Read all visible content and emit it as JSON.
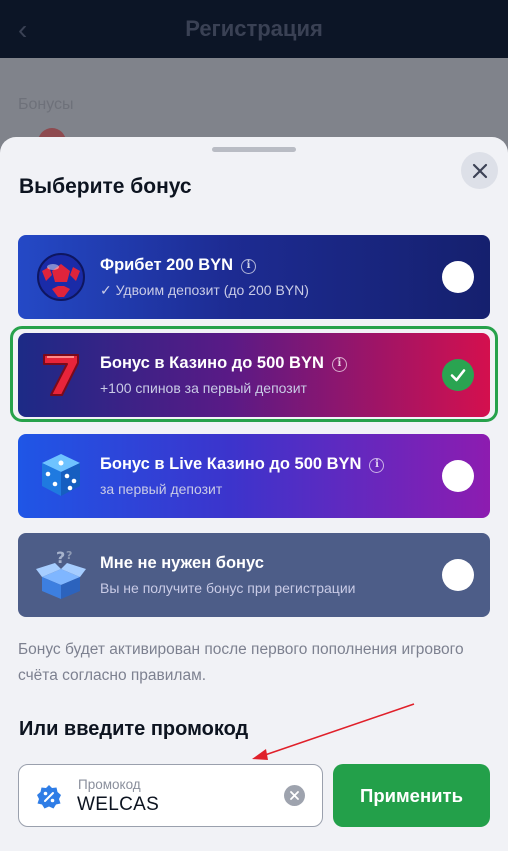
{
  "background": {
    "header_title": "Регистрация",
    "faint_text": "Бонусы"
  },
  "sheet": {
    "title": "Выберите бонус",
    "options": [
      {
        "title": "Фрибет 200 BYN",
        "subtitle": "✓ Удвоим депозит (до 200 BYN)",
        "icon": "football-icon",
        "selected": false
      },
      {
        "title": "Бонус в Казино до 500 BYN",
        "subtitle": "+100 спинов за первый депозит",
        "icon": "lucky-seven-icon",
        "selected": true
      },
      {
        "title": "Бонус в Live Казино до 500 BYN",
        "subtitle": "за первый депозит",
        "icon": "dice-icon",
        "selected": false
      },
      {
        "title": "Мне не нужен бонус",
        "subtitle": "Вы не получите бонус при регистрации",
        "icon": "question-box-icon",
        "selected": false
      }
    ],
    "note": "Бонус будет активирован после первого пополнения игрового счёта согласно правилам.",
    "promo_title": "Или введите промокод",
    "promo": {
      "label": "Промокод",
      "value": "WELCAS"
    },
    "apply_label": "Применить"
  },
  "colors": {
    "selected_border": "#27a24b",
    "apply_button": "#23a04a",
    "annotation_arrow": "#e0202a"
  }
}
